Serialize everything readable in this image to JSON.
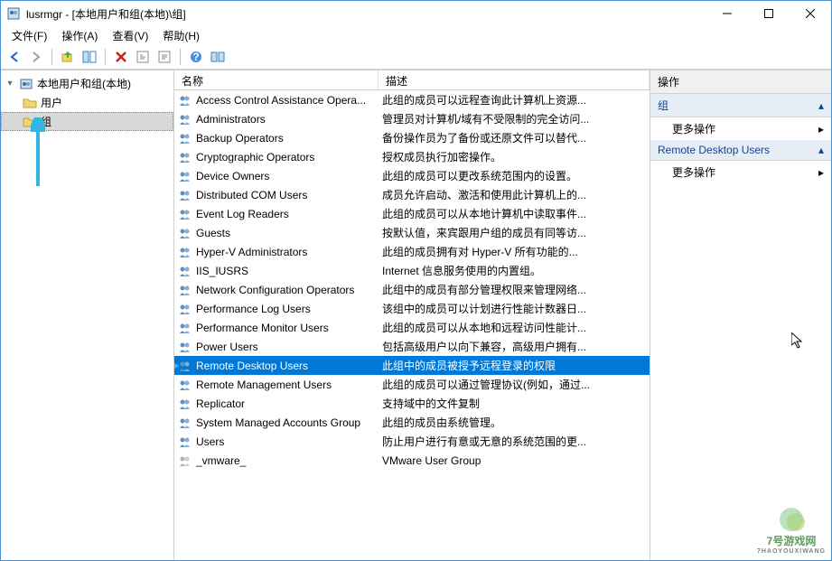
{
  "title": "lusrmgr - [本地用户和组(本地)\\组]",
  "menus": {
    "file": "文件(F)",
    "action": "操作(A)",
    "view": "查看(V)",
    "help": "帮助(H)"
  },
  "tree": {
    "root": "本地用户和组(本地)",
    "users": "用户",
    "groups": "组"
  },
  "list": {
    "header_name": "名称",
    "header_desc": "描述",
    "rows": [
      {
        "name": "Access Control Assistance Opera...",
        "desc": "此组的成员可以远程查询此计算机上资源...",
        "sel": false
      },
      {
        "name": "Administrators",
        "desc": "管理员对计算机/域有不受限制的完全访问...",
        "sel": false
      },
      {
        "name": "Backup Operators",
        "desc": "备份操作员为了备份或还原文件可以替代...",
        "sel": false
      },
      {
        "name": "Cryptographic Operators",
        "desc": "授权成员执行加密操作。",
        "sel": false
      },
      {
        "name": "Device Owners",
        "desc": "此组的成员可以更改系统范围内的设置。",
        "sel": false
      },
      {
        "name": "Distributed COM Users",
        "desc": "成员允许启动、激活和使用此计算机上的...",
        "sel": false
      },
      {
        "name": "Event Log Readers",
        "desc": "此组的成员可以从本地计算机中读取事件...",
        "sel": false
      },
      {
        "name": "Guests",
        "desc": "按默认值，来宾跟用户组的成员有同等访...",
        "sel": false
      },
      {
        "name": "Hyper-V Administrators",
        "desc": "此组的成员拥有对 Hyper-V 所有功能的...",
        "sel": false
      },
      {
        "name": "IIS_IUSRS",
        "desc": "Internet 信息服务使用的内置组。",
        "sel": false
      },
      {
        "name": "Network Configuration Operators",
        "desc": "此组中的成员有部分管理权限来管理网络...",
        "sel": false
      },
      {
        "name": "Performance Log Users",
        "desc": "该组中的成员可以计划进行性能计数器日...",
        "sel": false
      },
      {
        "name": "Performance Monitor Users",
        "desc": "此组的成员可以从本地和远程访问性能计...",
        "sel": false
      },
      {
        "name": "Power Users",
        "desc": "包括高级用户以向下兼容，高级用户拥有...",
        "sel": false
      },
      {
        "name": "Remote Desktop Users",
        "desc": "此组中的成员被授予远程登录的权限",
        "sel": true
      },
      {
        "name": "Remote Management Users",
        "desc": "此组的成员可以通过管理协议(例如，通过...",
        "sel": false
      },
      {
        "name": "Replicator",
        "desc": "支持域中的文件复制",
        "sel": false
      },
      {
        "name": "System Managed Accounts Group",
        "desc": "此组的成员由系统管理。",
        "sel": false
      },
      {
        "name": "Users",
        "desc": "防止用户进行有意或无意的系统范围的更...",
        "sel": false
      },
      {
        "name": "_vmware_",
        "desc": "VMware User Group",
        "sel": false,
        "tmp": true
      }
    ]
  },
  "actions": {
    "header": "操作",
    "section1": "组",
    "more": "更多操作",
    "section2": "Remote Desktop Users"
  },
  "watermark": {
    "main": "7号游戏网",
    "sub": "7HAOYOUXIWANG"
  }
}
